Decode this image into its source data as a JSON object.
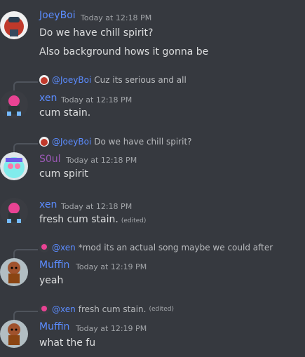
{
  "messages": [
    {
      "author": "JoeyBoi",
      "author_color": "#5b8cff",
      "time": "Today at 12:18 PM",
      "lines": [
        "Do we have chill spirit?",
        "Also background hows it gonna be"
      ]
    },
    {
      "reply": {
        "author": "@JoeyBoi",
        "text": "Cuz its serious and all"
      },
      "author": "xen",
      "author_color": "#5b8cff",
      "time": "Today at 12:18 PM",
      "lines": [
        "cum stain."
      ]
    },
    {
      "reply": {
        "author": "@JoeyBoi",
        "text": "Do we have chill spirit?"
      },
      "author": "S0ul",
      "author_color": "#9b59b6",
      "time": "Today at 12:18 PM",
      "lines": [
        "cum spirit"
      ]
    },
    {
      "author": "xen",
      "author_color": "#5b8cff",
      "time": "Today at 12:18 PM",
      "lines": [
        "fresh cum stain."
      ],
      "edited": "(edited)"
    },
    {
      "reply": {
        "author": "@xen",
        "text": "*mod its an actual song maybe we could after"
      },
      "author": "Muffin",
      "author_color": "#5b8cff",
      "time": "Today at 12:19 PM",
      "lines": [
        "yeah"
      ]
    },
    {
      "reply": {
        "author": "@xen",
        "text": "fresh cum stain.",
        "edited": "(edited)"
      },
      "author": "Muffin",
      "author_color": "#5b8cff",
      "time": "Today at 12:19 PM",
      "lines": [
        "what the  fu"
      ]
    }
  ]
}
